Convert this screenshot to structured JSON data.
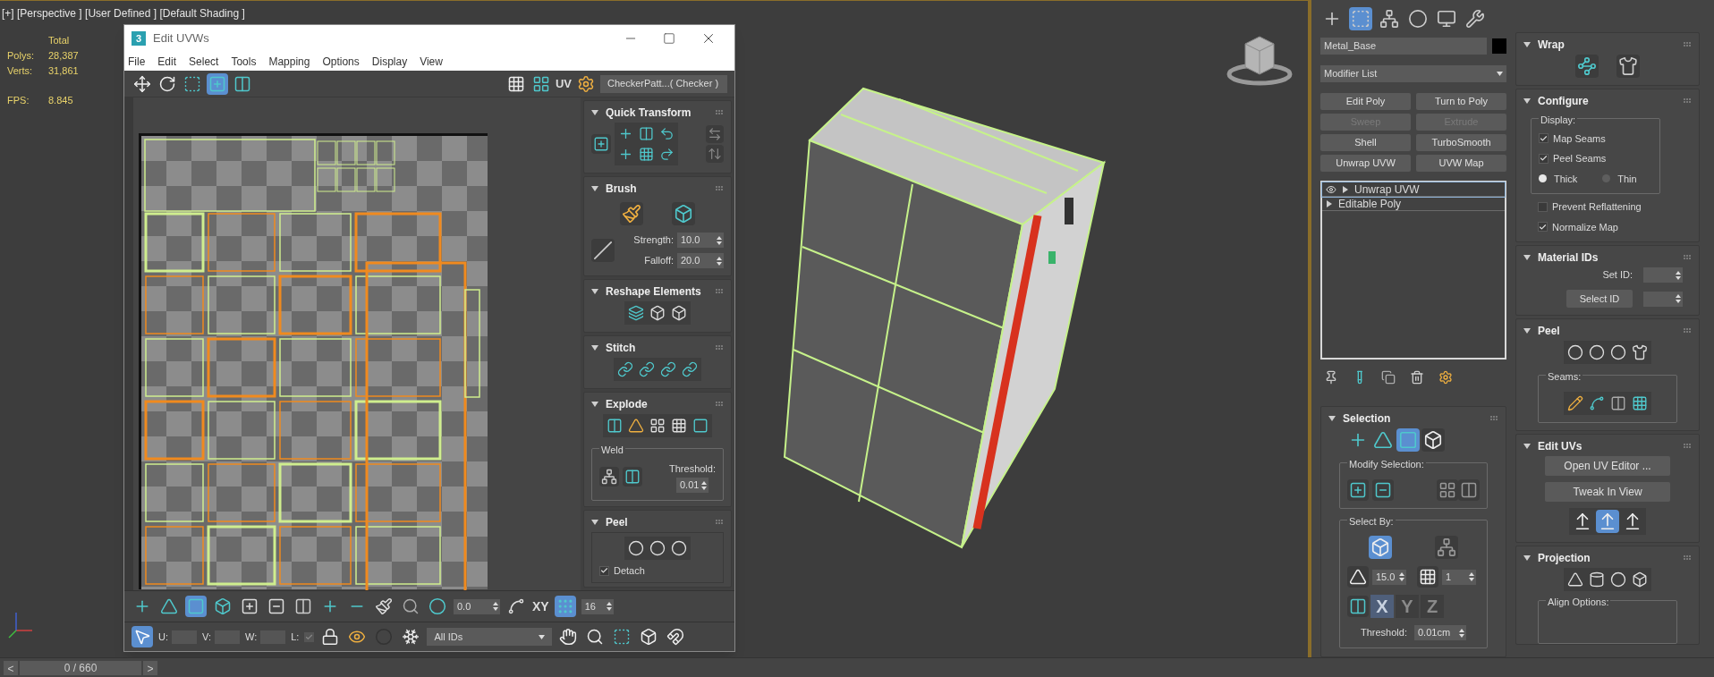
{
  "viewport": {
    "label": "[+] [Perspective ] [User Defined ] [Default Shading ]",
    "stats_header": "Total",
    "stats": [
      {
        "label": "Polys:",
        "value": "28,387"
      },
      {
        "label": "Verts:",
        "value": "31,861"
      }
    ],
    "fps": {
      "label": "FPS:",
      "value": "8.845"
    }
  },
  "uv_editor": {
    "logo": "3",
    "title": "Edit UVWs",
    "menu": [
      "File",
      "Edit",
      "Select",
      "Tools",
      "Mapping",
      "Options",
      "Display",
      "View"
    ],
    "toolbar_label": "UV",
    "texture": "CheckerPatt...( Checker )",
    "rollouts": [
      {
        "title": "Quick Transform",
        "kind": "quick_transform",
        "expanded": true
      },
      {
        "title": "Brush",
        "kind": "brush",
        "expanded": true,
        "fields": [
          {
            "label": "Strength:",
            "value": "10.0"
          },
          {
            "label": "Falloff:",
            "value": "20.0"
          }
        ]
      },
      {
        "title": "Reshape Elements",
        "kind": "reshape",
        "expanded": true
      },
      {
        "title": "Stitch",
        "kind": "stitch",
        "expanded": true
      },
      {
        "title": "Explode",
        "kind": "explode",
        "expanded": true,
        "group": "Weld",
        "field": {
          "label": "Threshold:",
          "value": "0.01"
        }
      },
      {
        "title": "Peel",
        "kind": "peel",
        "expanded": true,
        "checkbox": {
          "label": "Detach",
          "checked": true
        }
      }
    ],
    "bottom_toolbar": {
      "modes": [
        {
          "selected": false
        },
        {
          "selected": false
        },
        {
          "selected": true
        }
      ],
      "angle": "0.0",
      "axis_label": "XY",
      "pixel_snap": "16",
      "coords": [
        {
          "label": "U:"
        },
        {
          "label": "V:"
        },
        {
          "label": "W:"
        }
      ],
      "lock_label": "L:",
      "lock_checked": true,
      "ids": "All IDs"
    }
  },
  "command_panel": {
    "tabs": [
      {
        "selected": false
      },
      {
        "selected": true
      },
      {
        "selected": false
      },
      {
        "selected": false
      },
      {
        "selected": false
      },
      {
        "selected": false
      }
    ],
    "object_name": "Metal_Base",
    "modifier_list": "Modifier List",
    "modifier_buttons": [
      {
        "label": "Edit Poly",
        "disabled": false
      },
      {
        "label": "Turn to Poly",
        "disabled": false
      },
      {
        "label": "Sweep",
        "disabled": true
      },
      {
        "label": "Extrude",
        "disabled": true
      },
      {
        "label": "Shell",
        "disabled": false
      },
      {
        "label": "TurboSmooth",
        "disabled": false
      },
      {
        "label": "Unwrap UVW",
        "disabled": false
      },
      {
        "label": "UVW Map",
        "disabled": false
      }
    ],
    "stack": [
      {
        "label": "Unwrap UVW",
        "kind": "modifier",
        "selected": true,
        "expanded": false
      },
      {
        "label": "Editable Poly",
        "kind": "object",
        "selected": false,
        "expanded": false
      }
    ],
    "selection": {
      "title": "Selection",
      "expanded": true,
      "modes": [
        {
          "selected": false
        },
        {
          "selected": false
        },
        {
          "selected": true
        }
      ],
      "modify_group": "Modify Selection:",
      "select_by_group": "Select By:",
      "by_element_selected": true,
      "angle": "15.0",
      "count": "1",
      "axes": [
        {
          "label": "X",
          "selected": true
        },
        {
          "label": "Y",
          "selected": false
        },
        {
          "label": "Z",
          "selected": false
        }
      ],
      "threshold_label": "Threshold:",
      "threshold": "0.01cm"
    },
    "rollouts": [
      {
        "title": "Wrap",
        "kind": "wrap",
        "expanded": true
      },
      {
        "title": "Configure",
        "kind": "configure",
        "expanded": true,
        "group": "Display:",
        "display_checks": [
          {
            "label": "Map Seams",
            "checked": true
          },
          {
            "label": "Peel Seams",
            "checked": true
          }
        ],
        "thickness": [
          {
            "label": "Thick",
            "selected": true
          },
          {
            "label": "Thin",
            "selected": false
          }
        ],
        "checks": [
          {
            "label": "Prevent Reflattening",
            "checked": false
          },
          {
            "label": "Normalize Map",
            "checked": true
          }
        ]
      },
      {
        "title": "Material IDs",
        "kind": "material_ids",
        "expanded": true,
        "set_label": "Set ID:",
        "select_button": "Select ID"
      },
      {
        "title": "Peel",
        "kind": "peel",
        "expanded": true,
        "group": "Seams:"
      },
      {
        "title": "Edit UVs",
        "kind": "edit_uvs",
        "expanded": true,
        "buttons": [
          "Open UV Editor ...",
          "Tweak In View"
        ],
        "modes": [
          {
            "selected": false
          },
          {
            "selected": true
          },
          {
            "selected": false
          }
        ]
      },
      {
        "title": "Projection",
        "kind": "projection",
        "expanded": true,
        "group": "Align Options:"
      }
    ]
  },
  "timeline": {
    "prev": "<",
    "position": "0 / 660",
    "next": ">"
  }
}
